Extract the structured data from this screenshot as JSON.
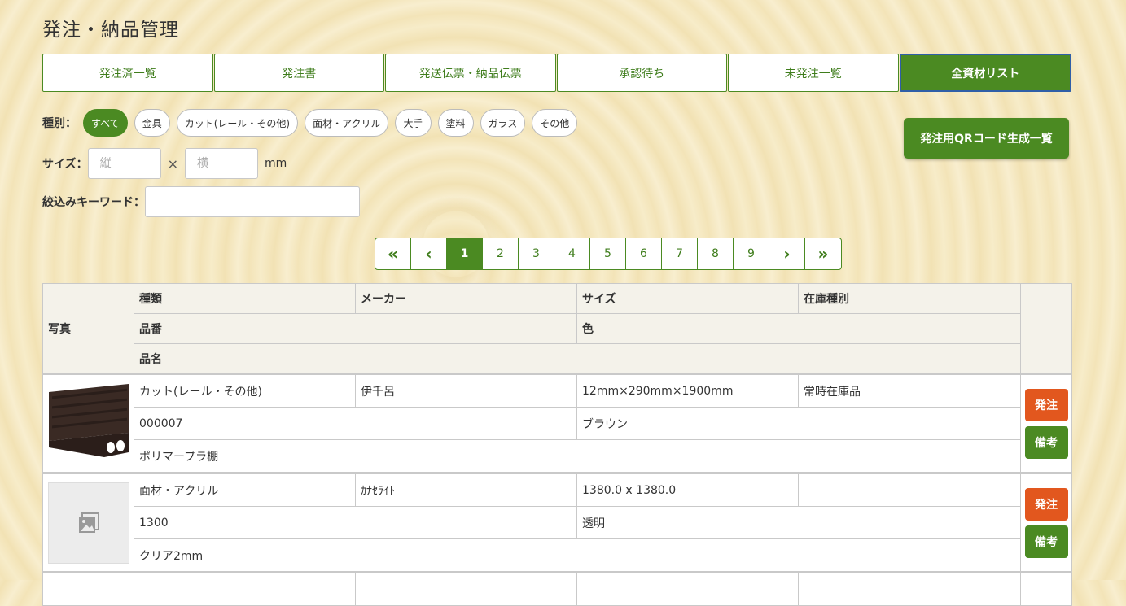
{
  "page_title": "発注・納品管理",
  "tabs": [
    {
      "label": "発注済一覧",
      "active": false
    },
    {
      "label": "発注書",
      "active": false
    },
    {
      "label": "発送伝票・納品伝票",
      "active": false
    },
    {
      "label": "承認待ち",
      "active": false
    },
    {
      "label": "未発注一覧",
      "active": false
    },
    {
      "label": "全資材リスト",
      "active": true
    }
  ],
  "filters": {
    "type_label": "種別：",
    "types": [
      "すべて",
      "金具",
      "カット(レール・その他)",
      "面材・アクリル",
      "大手",
      "塗料",
      "ガラス",
      "その他"
    ],
    "selected_type": "すべて",
    "size_label": "サイズ：",
    "height_placeholder": "縦",
    "width_placeholder": "横",
    "times": "×",
    "unit": "mm",
    "keyword_label": "絞込みキーワード：",
    "keyword_value": ""
  },
  "qr_button": "発注用QRコード生成一覧",
  "pagination": {
    "first": "«",
    "prev": "‹",
    "pages": [
      "1",
      "2",
      "3",
      "4",
      "5",
      "6",
      "7",
      "8",
      "9"
    ],
    "current": "1",
    "next": "›",
    "last": "»"
  },
  "table": {
    "headers": {
      "photo": "写真",
      "type": "種類",
      "maker": "メーカー",
      "size": "サイズ",
      "stock": "在庫種別",
      "code": "品番",
      "color": "色",
      "name": "品名"
    },
    "rows": [
      {
        "type": "カット(レール・その他)",
        "maker": "伊千呂",
        "size": "12mm×290mm×1900mm",
        "stock": "常時在庫品",
        "code": "000007",
        "color": "ブラウン",
        "name": "ポリマープラ棚",
        "has_photo": true
      },
      {
        "type": "面材・アクリル",
        "maker": "ｶﾅｾﾗｲﾄ",
        "size": "1380.0 x 1380.0",
        "stock": "",
        "code": "1300",
        "color": "透明",
        "name": "クリア2mm",
        "has_photo": false
      }
    ],
    "order_label": "発注",
    "note_label": "備考"
  },
  "colors": {
    "primary_green": "#4b8a22",
    "order_orange": "#e2571e"
  }
}
